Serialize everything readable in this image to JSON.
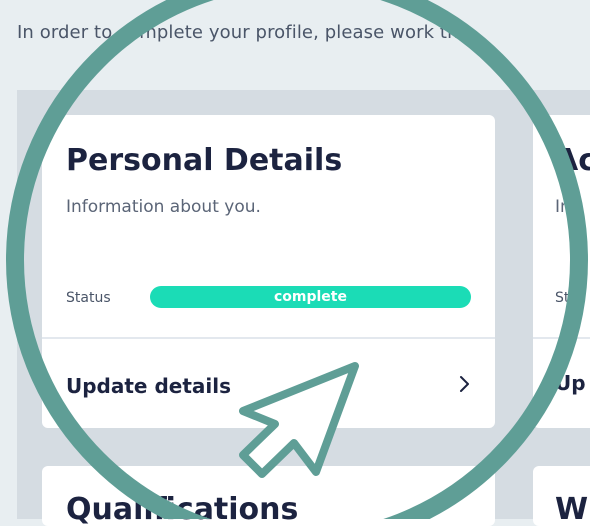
{
  "header": {
    "intro": "In order to complete your profile, please work th"
  },
  "cards": {
    "personal": {
      "title": "Personal Details",
      "subtitle": "Information about you.",
      "status_label": "Status",
      "status_value": "complete",
      "action_label": "Update details",
      "chevron_icon": "chevron-right-icon"
    },
    "right_partial": {
      "title": "Ac",
      "subtitle": "Inf",
      "status_label": "Sta",
      "action_label": "Up"
    },
    "bottom_left": {
      "title": "Qualifications"
    },
    "bottom_right": {
      "title": "W"
    }
  },
  "colors": {
    "accent_teal": "#1bdcb6",
    "highlight_ring": "#5f9e96",
    "text_dark": "#1c2340",
    "board_bg": "#d5dce2"
  },
  "overlay": {
    "ring_icon": "highlight-ring-icon",
    "cursor_icon": "arrow-cursor-icon"
  }
}
